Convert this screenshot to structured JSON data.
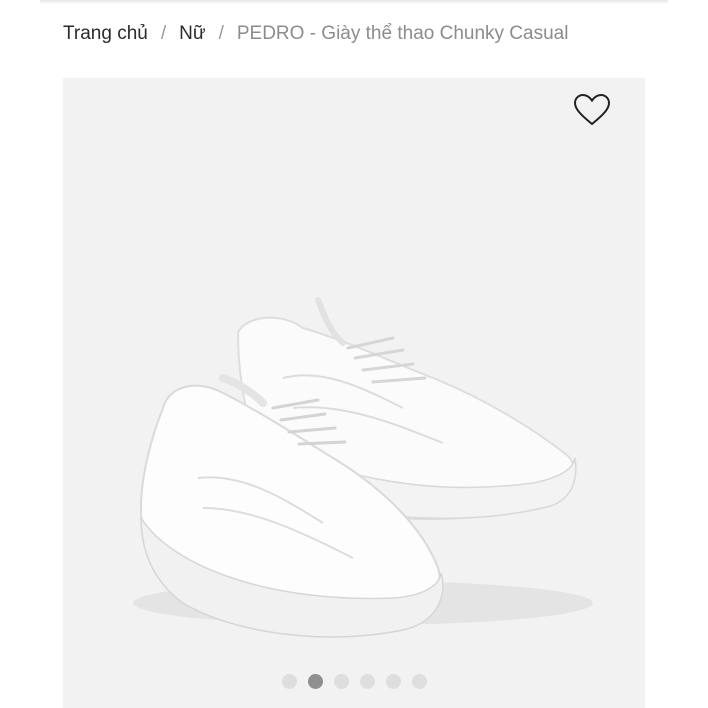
{
  "breadcrumb": {
    "items": [
      {
        "label": "Trang chủ"
      },
      {
        "label": "Nữ"
      }
    ],
    "separator": "/",
    "current": "PEDRO - Giày thể thao Chunky Casual"
  },
  "gallery": {
    "wishlist_icon": "heart-outline-icon",
    "slide_count": 6,
    "active_slide": 2,
    "background": "#f2f2f2"
  }
}
